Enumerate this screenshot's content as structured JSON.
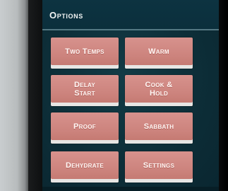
{
  "panel": {
    "title": "Options"
  },
  "buttons": {
    "two_temps": "Two Temps",
    "warm": "Warm",
    "delay_start_line1": "Delay",
    "delay_start_line2": "Start",
    "cook_hold_line1": "Cook &",
    "cook_hold_line2": "Hold",
    "proof": "Proof",
    "sabbath": "Sabbath",
    "dehydrate": "Dehydrate",
    "settings": "Settings"
  },
  "colors": {
    "screen_bg": "#0d2e38",
    "button_fill": "#cc837d",
    "title_text": "#f2f4f4"
  }
}
